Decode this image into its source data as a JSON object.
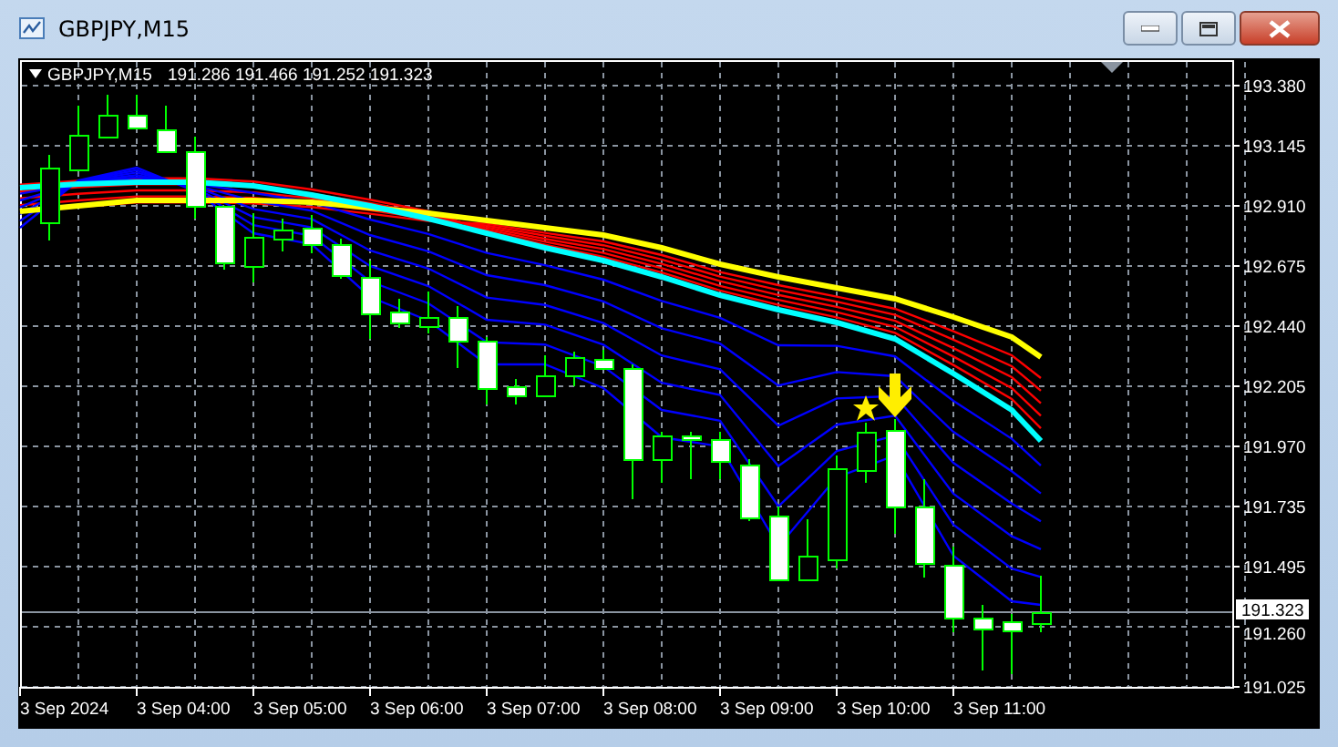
{
  "window": {
    "title": "GBPJPY,M15"
  },
  "chart": {
    "symbol": "GBPJPY,M15",
    "ohlc": "191.286 191.466 191.252 191.323",
    "price_labels": [
      "193.380",
      "193.145",
      "192.910",
      "192.675",
      "192.440",
      "192.205",
      "191.970",
      "191.735",
      "191.495",
      "191.260",
      "191.025"
    ],
    "current_price": "191.323",
    "time_labels": [
      "3 Sep 2024",
      "3 Sep 04:00",
      "3 Sep 05:00",
      "3 Sep 06:00",
      "3 Sep 07:00",
      "3 Sep 08:00",
      "3 Sep 09:00",
      "3 Sep 10:00",
      "3 Sep 11:00"
    ]
  }
}
